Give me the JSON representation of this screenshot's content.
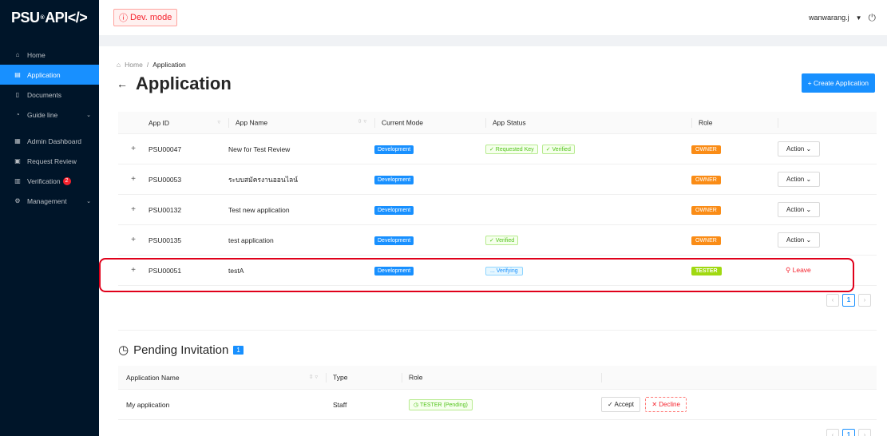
{
  "app": {
    "logo_prefix": "PSU",
    "logo_suffix": "API</>",
    "dev_mode": "Dev. mode"
  },
  "header": {
    "username": "wanwarang.j"
  },
  "sidebar": {
    "items": [
      {
        "label": "Home",
        "icon": "home-icon"
      },
      {
        "label": "Application",
        "icon": "app-icon"
      },
      {
        "label": "Documents",
        "icon": "document-icon"
      },
      {
        "label": "Guide line",
        "icon": "guide-icon"
      },
      {
        "label": "Admin Dashboard",
        "icon": "dashboard-icon"
      },
      {
        "label": "Request Review",
        "icon": "review-icon"
      },
      {
        "label": "Verification",
        "icon": "verification-icon",
        "badge": "2"
      },
      {
        "label": "Management",
        "icon": "settings-icon"
      }
    ]
  },
  "breadcrumb": {
    "home": "Home",
    "sep": "/",
    "current": "Application"
  },
  "page": {
    "title": "Application",
    "create_label": "+ Create Application"
  },
  "table": {
    "columns": [
      "App ID",
      "App Name",
      "Current Mode",
      "App Status",
      "Role"
    ],
    "rows": [
      {
        "id": "PSU00047",
        "name": "New for Test Review",
        "mode": "Development",
        "status": [
          "✓ Requested Key",
          "✓ Verified"
        ],
        "role": "OWNER",
        "action": "Action"
      },
      {
        "id": "PSU00053",
        "name": "ระบบสมัครงานออนไลน์",
        "mode": "Development",
        "status": [],
        "role": "OWNER",
        "action": "Action"
      },
      {
        "id": "PSU00132",
        "name": "Test new application",
        "mode": "Development",
        "status": [],
        "role": "OWNER",
        "action": "Action"
      },
      {
        "id": "PSU00135",
        "name": "test application",
        "mode": "Development",
        "status": [
          "✓ Verified"
        ],
        "role": "OWNER",
        "action": "Action"
      },
      {
        "id": "PSU00051",
        "name": "testA",
        "mode": "Development",
        "status": [
          "... Verifying"
        ],
        "role": "TESTER",
        "action": "Leave"
      }
    ],
    "page": "1"
  },
  "pending": {
    "title": "Pending Invitation",
    "count": "1",
    "columns": [
      "Application Name",
      "Type",
      "Role"
    ],
    "rows": [
      {
        "name": "My application",
        "type": "Staff",
        "role": "TESTER (Pending)",
        "accept": "Accept",
        "decline": "Decline"
      }
    ],
    "page": "1"
  },
  "colors": {
    "primary": "#1890ff",
    "sidebar_bg": "#001529",
    "owner": "#fa8c16",
    "tester": "#a0d911",
    "danger": "#f5222d",
    "highlight": "#e0001a"
  }
}
